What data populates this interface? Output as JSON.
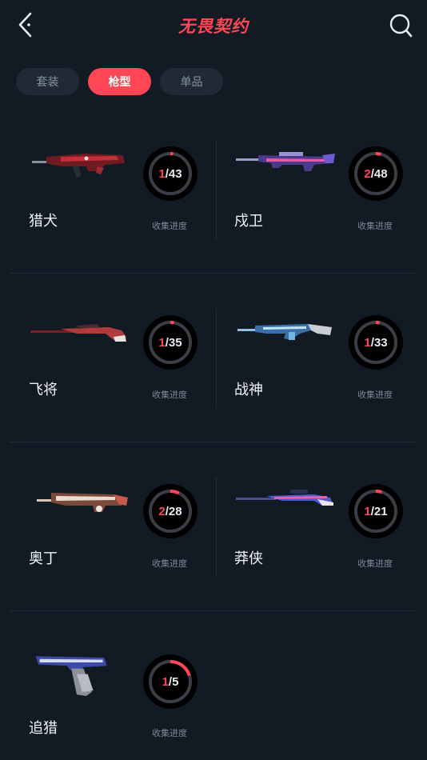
{
  "header": {
    "title": "无畏契约",
    "back_icon": "chevron-left-icon",
    "search_icon": "search-icon"
  },
  "tabs": [
    {
      "label": "套装",
      "active": false
    },
    {
      "label": "枪型",
      "active": true
    },
    {
      "label": "单品",
      "active": false
    }
  ],
  "progress_label": "收集进度",
  "weapons": [
    {
      "name": "猎犬",
      "collected": "1",
      "total": "43",
      "fraction": 0.023
    },
    {
      "name": "戍卫",
      "collected": "2",
      "total": "48",
      "fraction": 0.042
    },
    {
      "name": "飞将",
      "collected": "1",
      "total": "35",
      "fraction": 0.029
    },
    {
      "name": "战神",
      "collected": "1",
      "total": "33",
      "fraction": 0.03
    },
    {
      "name": "奥丁",
      "collected": "2",
      "total": "28",
      "fraction": 0.071
    },
    {
      "name": "莽侠",
      "collected": "1",
      "total": "21",
      "fraction": 0.048
    },
    {
      "name": "追猎",
      "collected": "1",
      "total": "5",
      "fraction": 0.2
    }
  ],
  "colors": {
    "accent": "#ff4655",
    "background": "#121a24",
    "ring_track": "#3a3f45"
  }
}
